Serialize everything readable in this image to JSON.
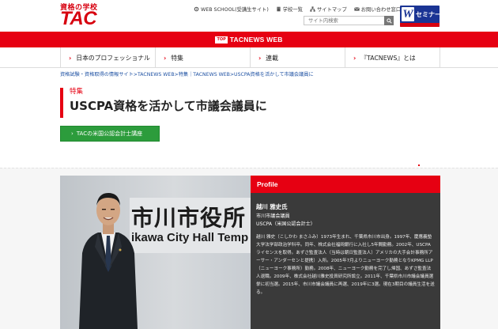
{
  "header": {
    "logo_sub": "資格の学校",
    "logo_main": "TAC",
    "links": [
      {
        "label": "WEB SCHOOL(受講生サイト)",
        "icon": "gear-icon"
      },
      {
        "label": "学校一覧",
        "icon": "building-icon"
      },
      {
        "label": "サイトマップ",
        "icon": "sitemap-icon"
      },
      {
        "label": "お問い合わせ窓口",
        "icon": "mail-icon"
      }
    ],
    "search_placeholder": "サイト内検索",
    "wseminar_label": "セミナー",
    "wseminar_mark": "W"
  },
  "banner": {
    "badge": "TOP",
    "title": "TACNEWS WEB"
  },
  "nav": {
    "items": [
      {
        "label": "日本のプロフェッショナル"
      },
      {
        "label": "特集"
      },
      {
        "label": "連載"
      },
      {
        "label": "『TACNEWS』とは"
      }
    ]
  },
  "breadcrumb": "資格試験・資格取得の情報サイト>TACNEWS WEB>特集｜TACNEWS WEB>USCPA資格を活かして市議会議員に",
  "page": {
    "category": "特集",
    "title": "USCPA資格を活かして市議会議員に",
    "cta_label": "TACの米国公認会計士講座"
  },
  "photo": {
    "sign_jp": "市川市役所",
    "sign_en": "ikawa City Hall Temp"
  },
  "profile": {
    "heading": "Profile",
    "name": "越川 雅史氏",
    "role1": "市川市議会議員",
    "role2": "USCPA（米国公認会計士）",
    "bio": "越川 雅史（こしかわ まさふみ）1973年生まれ、千葉県市川市出身。1997年、慶應義塾大学法学部政治学科卒。同年、株式会社福岡銀行に入社し5年間勤務。2002年、USCPAライセンスを取得。あずさ監査法人（当時は朝日監査法人）アメリカの大手会計事務所アーサー・アンダーセンと提携）入所。2005年7月よりニューヨーク勤務となりKPMG LLP（ニューヨーク事務所）勤務。2008年、ニューヨーク勤務を完了し帰国、あずさ監査法人退職。2009年、株式会社越川雅史投資研究所設立。2011年、千葉県市川市議会議員選挙に初当選。2015年、市川市議会議員に再選、2019年に3選。現在3期目の議員生活を送る。"
  },
  "colors": {
    "brand_red": "#e60012",
    "cta_green": "#2c9c3c",
    "wseminar_blue": "#1a3494",
    "profile_bg": "#3a3a3a"
  }
}
